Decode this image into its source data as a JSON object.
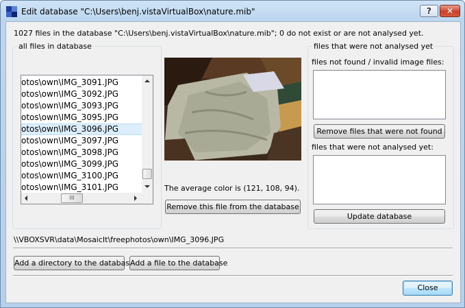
{
  "window": {
    "title": "Edit database \"C:\\Users\\benj.vistaVirtualBox\\nature.mib\"",
    "help": "?",
    "close_glyph": "✕"
  },
  "summary": "1027 files in the database \"C:\\Users\\benj.vistaVirtualBox\\nature.mib\"; 0 do not exist or are not analysed yet.",
  "all_files": {
    "group_title": "all files in database",
    "items": [
      "otos\\own\\IMG_3091.JPG",
      "otos\\own\\IMG_3092.JPG",
      "otos\\own\\IMG_3093.JPG",
      "otos\\own\\IMG_3095.JPG",
      "otos\\own\\IMG_3096.JPG",
      "otos\\own\\IMG_3097.JPG",
      "otos\\own\\IMG_3098.JPG",
      "otos\\own\\IMG_3099.JPG",
      "otos\\own\\IMG_3100.JPG",
      "otos\\own\\IMG_3101.JPG"
    ],
    "selected_index": 4,
    "hscroll_grip": "III",
    "vscroll_fraction": 0.95
  },
  "preview": {
    "average_color_text": "The average color is (121, 108, 94).",
    "remove_button": "Remove this file from the database"
  },
  "not_analysed": {
    "group_title": "files that were not analysed yet",
    "not_found_label": "files not found / invalid image files:",
    "remove_not_found_button": "Remove files that were not found",
    "not_analysed_label": "files that were not analysed yet:",
    "update_button": "Update database"
  },
  "current_path": "\\\\VBOXSVR\\data\\MosaicIt\\freephotos\\own\\IMG_3096.JPG",
  "add_directory_button": "Add a directory to the database",
  "add_file_button": "Add a file to the database",
  "close_button": "Close"
}
